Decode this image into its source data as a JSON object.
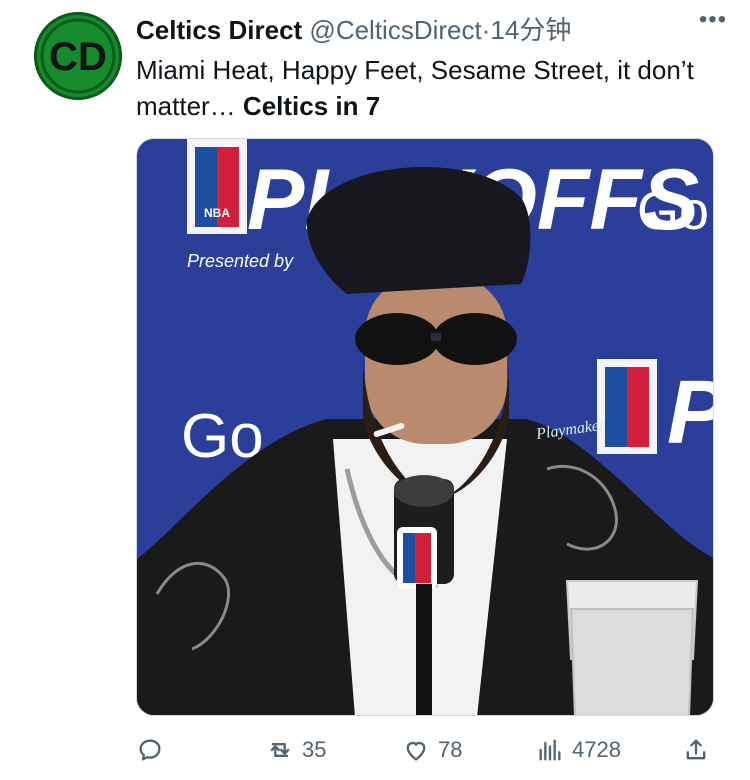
{
  "tweet": {
    "author_name": "Celtics Direct",
    "handle": "@CelticsDirect",
    "separator": "·",
    "time": "14分钟",
    "avatar_text": "CD",
    "text_plain": "Miami Heat, Happy Feet, Sesame Street, it don’t matter… ",
    "text_bold": "Celtics in 7",
    "more_icon": "more-dots-icon"
  },
  "media": {
    "backdrop_text": [
      "PLAYOFFS",
      "Presented by",
      "Go",
      "NBA"
    ],
    "watermark": "Playmaker",
    "description_icon": "photo"
  },
  "actions": {
    "reply_count": "",
    "retweet_count": "35",
    "like_count": "78",
    "views_count": "4728"
  },
  "colors": {
    "brand_green": "#178a2c",
    "muted_text": "#536471",
    "backdrop_blue": "#2b3f9a"
  }
}
